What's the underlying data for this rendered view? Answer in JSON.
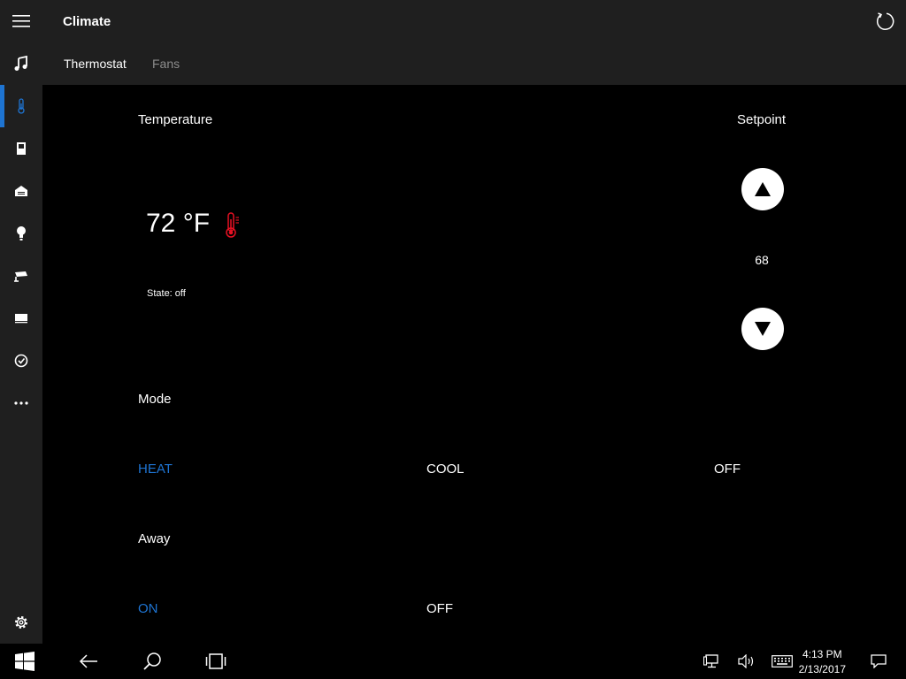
{
  "app": {
    "title": "Climate"
  },
  "tabs": {
    "thermostat": "Thermostat",
    "fans": "Fans"
  },
  "temperature": {
    "label": "Temperature",
    "value": "72 °F",
    "state": "State: off"
  },
  "setpoint": {
    "label": "Setpoint",
    "value": "68"
  },
  "mode": {
    "label": "Mode",
    "options": [
      "HEAT",
      "COOL",
      "OFF"
    ],
    "selected": "HEAT"
  },
  "away": {
    "label": "Away",
    "options": [
      "ON",
      "OFF"
    ],
    "selected": "ON"
  },
  "taskbar": {
    "time": "4:13 PM",
    "date": "2/13/2017"
  },
  "colors": {
    "accent": "#1e74d2",
    "chrome": "#1f1f1f",
    "thermometer": "#e81123"
  },
  "sidebar_icons": [
    "hamburger-menu-icon",
    "music-icon",
    "thermometer-icon",
    "door-icon",
    "garage-icon",
    "lightbulb-icon",
    "security-camera-icon",
    "shade-icon",
    "checkmark-circle-icon",
    "more-icon",
    "settings-icon"
  ]
}
